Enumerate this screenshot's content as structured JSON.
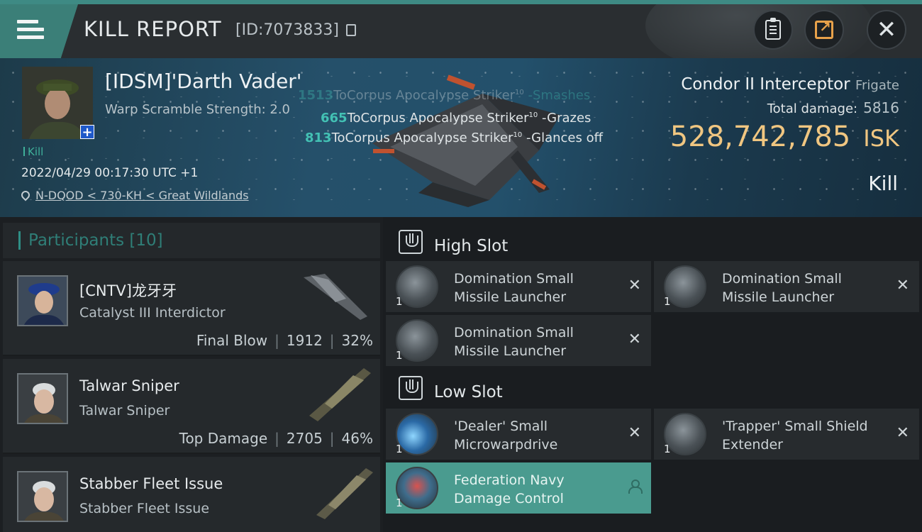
{
  "header": {
    "title": "KILL REPORT",
    "report_id": "[ID:7073833]",
    "icons": [
      "menu-icon",
      "copy-icon",
      "clipboard-icon",
      "share-icon",
      "close-icon"
    ]
  },
  "victim": {
    "name": "[IDSM]'Darth Vader'",
    "warp_scramble": "Warp Scramble Strength: 2.0",
    "tag": "Kill",
    "datetime": "2022/04/29 00:17:30 UTC +1",
    "location": "N-DQOD < 730-KH < Great Wildlands",
    "ship_name": "Condor II Interceptor",
    "ship_class": "Frigate",
    "total_damage_label": "Total damage:",
    "total_damage": "5816",
    "isk_value": "528,742,785",
    "isk_unit": "ISK",
    "result": "Kill"
  },
  "damage_log": [
    {
      "amount": "1513",
      "text": "ToCorpus Apocalypse Striker",
      "level": "10",
      "result": "-Smashes"
    },
    {
      "amount": "665",
      "text": "ToCorpus Apocalypse Striker",
      "level": "10",
      "result": "-Grazes"
    },
    {
      "amount": "813",
      "text": "ToCorpus Apocalypse Striker",
      "level": "10",
      "result": "-Glances off"
    }
  ],
  "participants": {
    "label": "Participants",
    "count": "[10]",
    "rows": [
      {
        "name": "[CNTV]龙牙牙",
        "ship": "Catalyst III Interdictor",
        "role": "Final Blow",
        "damage": "1912",
        "percent": "32%"
      },
      {
        "name": "Talwar Sniper",
        "ship": "Talwar Sniper",
        "role": "Top Damage",
        "damage": "2705",
        "percent": "46%"
      },
      {
        "name": "Stabber Fleet Issue",
        "ship": "Stabber Fleet Issue",
        "role": "",
        "damage": "",
        "percent": ""
      }
    ]
  },
  "fitting": {
    "high_slot_label": "High Slot",
    "low_slot_label": "Low Slot",
    "high": [
      {
        "line1": "Domination Small",
        "line2": "Missile Launcher",
        "qty": "1"
      },
      {
        "line1": "Domination Small",
        "line2": "Missile Launcher",
        "qty": "1"
      },
      {
        "line1": "Domination Small",
        "line2": "Missile Launcher",
        "qty": "1"
      }
    ],
    "low": [
      {
        "line1": "'Dealer' Small",
        "line2": "Microwarpdrive",
        "qty": "1"
      },
      {
        "line1": "'Trapper' Small Shield",
        "line2": "Extender",
        "qty": "1"
      },
      {
        "line1": "Federation Navy",
        "line2": "Damage Control",
        "qty": "1"
      }
    ]
  }
}
